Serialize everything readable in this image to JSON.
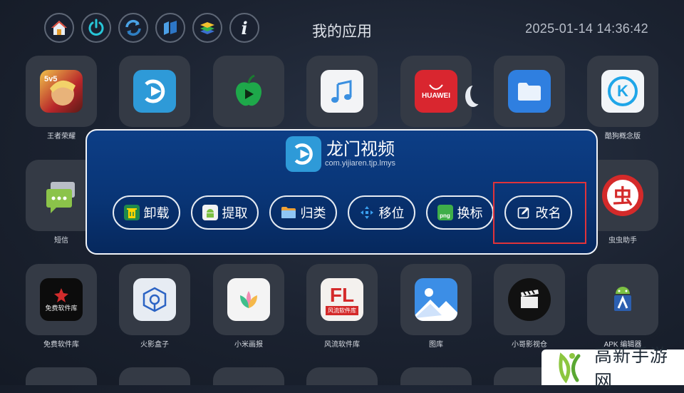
{
  "header": {
    "title": "我的应用",
    "datetime": "2025-01-14 14:36:42",
    "icons": [
      "home-icon",
      "power-icon",
      "refresh-icon",
      "cube-icon",
      "layers-icon",
      "info-icon"
    ]
  },
  "apps": {
    "row1": [
      {
        "name": "王者荣耀",
        "icon": "game-hero-icon"
      },
      {
        "name": "",
        "icon": "video-play-icon"
      },
      {
        "name": "",
        "icon": "apple-play-icon"
      },
      {
        "name": "",
        "icon": "music-icon"
      },
      {
        "name": "",
        "icon": "huawei-icon",
        "icon_text": "HUAWEI"
      },
      {
        "name": "",
        "icon": "folder-icon"
      },
      {
        "name": "酷狗概念版",
        "icon": "kugou-icon",
        "icon_text": "K"
      }
    ],
    "row2": [
      {
        "name": "短信",
        "icon": "message-icon"
      },
      {
        "name": "虫虫助手",
        "icon": "chongchong-icon",
        "icon_text": "虫"
      }
    ],
    "row3": [
      {
        "name": "免费软件库",
        "icon": "software-lib-icon",
        "icon_text": "免费软件库"
      },
      {
        "name": "火影盒子",
        "icon": "box-icon"
      },
      {
        "name": "小米画报",
        "icon": "flower-icon"
      },
      {
        "name": "风流软件库",
        "icon": "fl-icon",
        "icon_text": "FL",
        "icon_sub": "风流软件库"
      },
      {
        "name": "图库",
        "icon": "gallery-icon"
      },
      {
        "name": "小哥影视仓",
        "icon": "clapper-icon"
      },
      {
        "name": "APK 编辑器",
        "icon": "apk-editor-icon"
      }
    ]
  },
  "dialog": {
    "app_name": "龙门视频",
    "package": "com.yijiaren.tjp.lmys",
    "actions": [
      {
        "label": "卸载",
        "icon": "trash-icon"
      },
      {
        "label": "提取",
        "icon": "android-icon"
      },
      {
        "label": "归类",
        "icon": "folder-icon"
      },
      {
        "label": "移位",
        "icon": "move-icon"
      },
      {
        "label": "换标",
        "icon": "png-icon",
        "icon_text": "png"
      },
      {
        "label": "改名",
        "icon": "edit-icon"
      }
    ],
    "focused_action": "改名"
  },
  "watermark": {
    "text": "高新手游网"
  },
  "colors": {
    "dialog_bg": "#0b3a80",
    "focus_border": "#e0333a",
    "tile_bg": "#343a45"
  }
}
